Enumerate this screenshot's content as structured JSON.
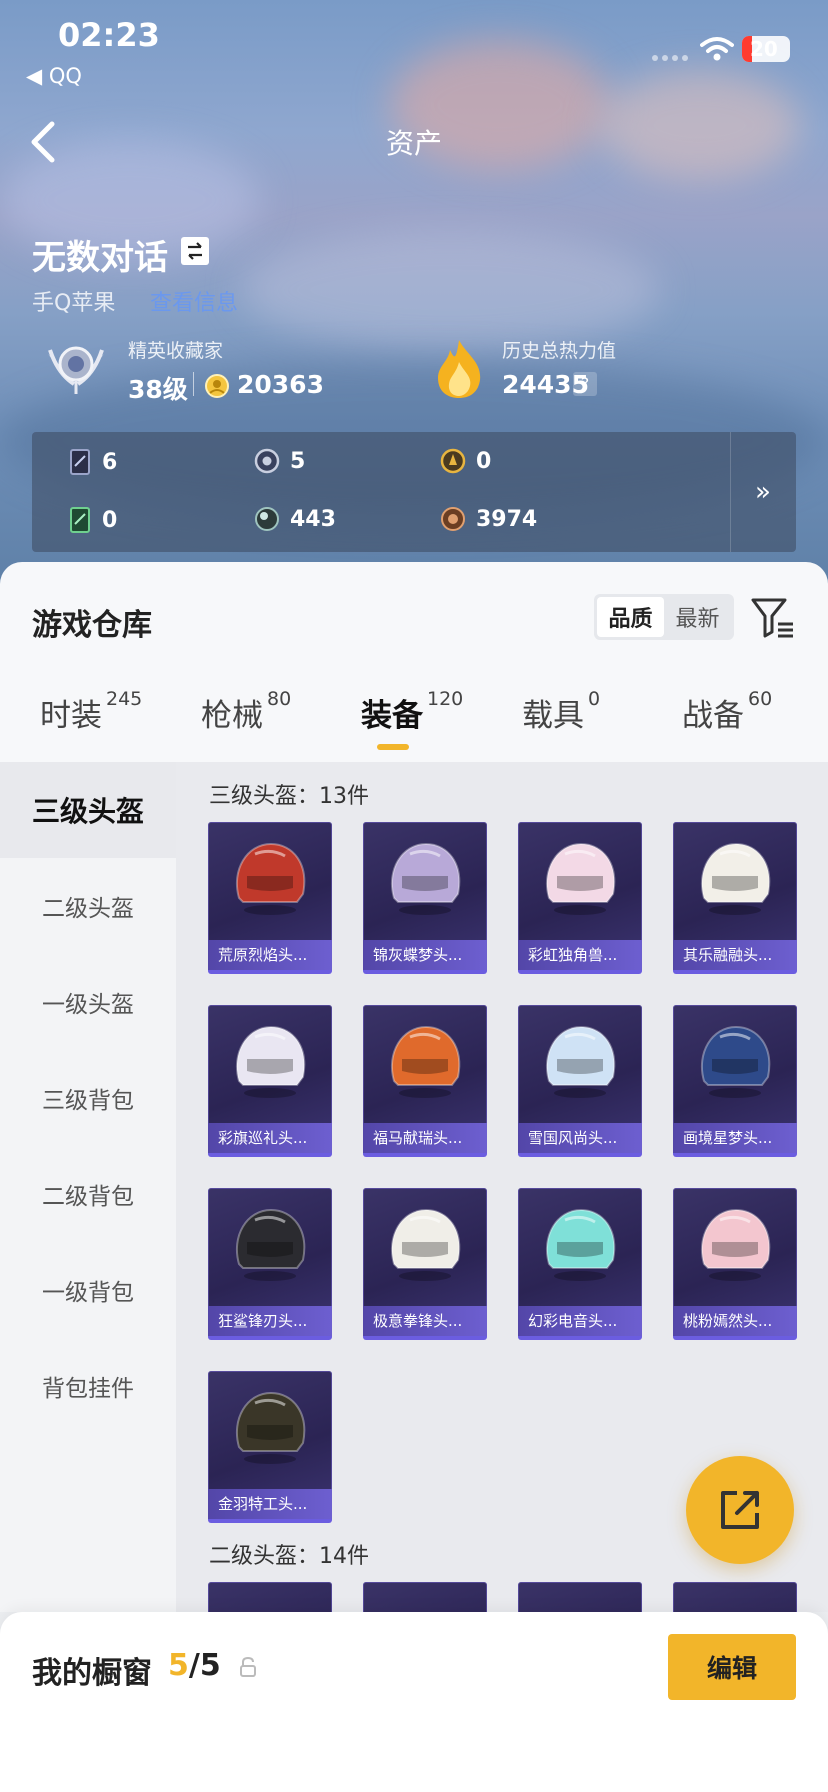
{
  "status_bar": {
    "time": "02:23",
    "back_app": "◀ QQ",
    "battery": "20"
  },
  "nav": {
    "title": "资产",
    "back_icon": "chevron-left-icon"
  },
  "profile": {
    "name": "无数对话",
    "switch_icon": "swap-icon",
    "platform": "手Q苹果",
    "platform_link": "查看信息",
    "rank_title": "精英收藏家",
    "rank_level": "38级",
    "coins": "20363",
    "heat_label": "历史总热力值",
    "heat_value": "24435",
    "help": "?"
  },
  "stats": [
    {
      "icon": "card-icon",
      "value": "6"
    },
    {
      "icon": "badge-silver-icon",
      "value": "5"
    },
    {
      "icon": "badge-gold-icon",
      "value": "0"
    },
    {
      "icon": "green-card-icon",
      "value": "0"
    },
    {
      "icon": "orb-icon",
      "value": "443"
    },
    {
      "icon": "bronze-coin-icon",
      "value": "3974"
    }
  ],
  "stats_more": "»",
  "warehouse": {
    "title": "游戏仓库",
    "sort_options": [
      "品质",
      "最新"
    ],
    "sort_active": "品质",
    "filter_icon": "filter-icon"
  },
  "tabs": [
    {
      "label": "时装",
      "count": "245"
    },
    {
      "label": "枪械",
      "count": "80"
    },
    {
      "label": "装备",
      "count": "120"
    },
    {
      "label": "载具",
      "count": "0"
    },
    {
      "label": "战备",
      "count": "60"
    }
  ],
  "active_tab": "装备",
  "sidebar": [
    "三级头盔",
    "二级头盔",
    "一级头盔",
    "三级背包",
    "二级背包",
    "一级背包",
    "背包挂件"
  ],
  "sections": [
    {
      "title": "三级头盔：13件",
      "items": [
        "荒原烈焰头...",
        "锦灰蝶梦头...",
        "彩虹独角兽...",
        "其乐融融头...",
        "彩旗巡礼头...",
        "福马献瑞头...",
        "雪国风尚头...",
        "画境星梦头...",
        "狂鲨锋刃头...",
        "极意拳锋头...",
        "幻彩电音头...",
        "桃粉嫣然头...",
        "金羽特工头..."
      ]
    },
    {
      "title": "二级头盔：14件",
      "items": []
    }
  ],
  "helmet_colors": [
    "#c0392b",
    "#b8a9d8",
    "#f3d9e6",
    "#f2efe8",
    "#e9e6f2",
    "#e06a2c",
    "#cfe2f5",
    "#2e4a8a",
    "#2b2b30",
    "#f0eee8",
    "#7fe0d8",
    "#f3c6cf",
    "#3a3628"
  ],
  "share_icon": "share-icon",
  "showcase": {
    "title": "我的橱窗",
    "used": "5",
    "total": "/5",
    "lock_icon": "lock-icon",
    "edit_label": "编辑"
  }
}
